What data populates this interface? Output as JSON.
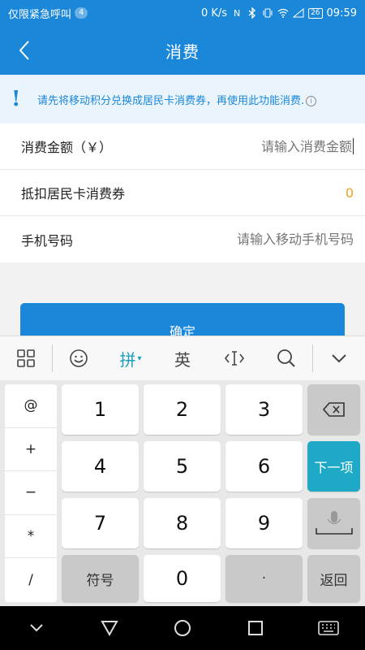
{
  "status": {
    "carrier": "仅限紧急呼叫",
    "badge": "4",
    "net_speed": "0 K/s",
    "battery": "26",
    "time": "09:59"
  },
  "nav": {
    "title": "消费"
  },
  "notice": {
    "text": "请先将移动积分兑换成居民卡消费券，再使用此功能消费."
  },
  "form": {
    "amount_label": "消费金额（￥）",
    "amount_placeholder": "请输入消费金额",
    "voucher_label": "抵扣居民卡消费券",
    "voucher_value": "0",
    "phone_label": "手机号码",
    "phone_placeholder": "请输入移动手机号码"
  },
  "confirm_label": "确定",
  "keyboard": {
    "toolbar": {
      "pinyin": "拼",
      "english": "英"
    },
    "symbols": [
      "@",
      "+",
      "−",
      "*",
      "/"
    ],
    "digits": [
      "1",
      "2",
      "3",
      "4",
      "5",
      "6",
      "7",
      "8",
      "9",
      "0"
    ],
    "symbol_key": "符号",
    "dot_key": "·",
    "next_key": "下一项",
    "return_key": "返回"
  },
  "colors": {
    "primary": "#1a87d9",
    "accent": "#1eaac6",
    "orange": "#f0a020"
  }
}
